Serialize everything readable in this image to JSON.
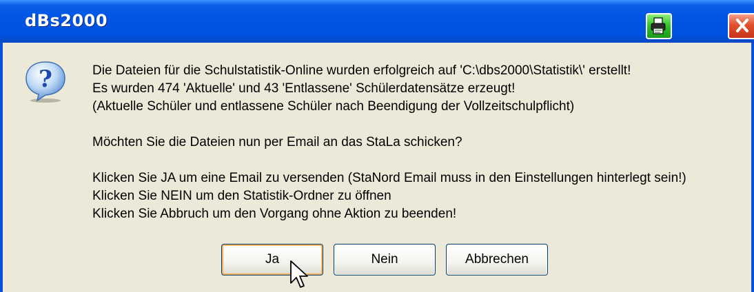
{
  "window": {
    "title": "dBs2000"
  },
  "titlebar": {
    "print_icon": "printer-icon",
    "close_icon": "close-icon"
  },
  "dialog": {
    "icon": "question-icon",
    "lines": [
      "Die Dateien für die Schulstatistik-Online wurden erfolgreich auf 'C:\\dbs2000\\Statistik\\' erstellt!",
      "Es wurden 474 'Aktuelle' und 43 'Entlassene' Schülerdatensätze erzeugt!",
      "(Aktuelle Schüler und entlassene Schüler nach Beendigung der Vollzeitschulpflicht)",
      "",
      "Möchten Sie die Dateien nun per Email an das StaLa schicken?",
      "",
      "Klicken Sie JA um eine Email zu versenden (StaNord Email muss in den Einstellungen hinterlegt sein!)",
      "Klicken Sie NEIN um den Statistik-Ordner zu öffnen",
      "Klicken Sie Abbruch um den Vorgang ohne Aktion zu beenden!"
    ]
  },
  "buttons": {
    "yes": "Ja",
    "no": "Nein",
    "cancel": "Abbrechen"
  },
  "colors": {
    "titlebar": "#0055e5",
    "dialog_bg": "#ece9d8",
    "button_border": "#003c74",
    "focus_ring": "#f8b35b"
  }
}
